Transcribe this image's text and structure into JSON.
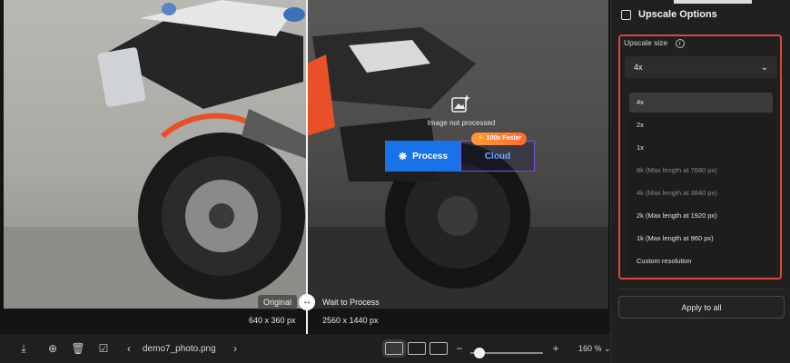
{
  "canvas": {
    "label_original": "Original",
    "label_wait": "Wait to Process",
    "original_dims": "640 x 360 px",
    "processed_dims": "2560 x 1440 px",
    "status_text": "Image not processed",
    "process_button": "Process",
    "cloud_button": "Cloud",
    "faster_badge": "100x Faster"
  },
  "toolbar": {
    "filename": "demo7_photo.png",
    "zoom": "160 %",
    "zoom_slider_fraction": 0.12
  },
  "panel": {
    "title": "Upscale Options",
    "upscale_size_label": "Upscale size",
    "info_glyph": "i",
    "selected": "4x",
    "options": [
      {
        "label": "4x",
        "enabled": true
      },
      {
        "label": "2x",
        "enabled": true
      },
      {
        "label": "1x",
        "enabled": true
      },
      {
        "label": "8k (Max length at 7680 px)",
        "enabled": false
      },
      {
        "label": "4k (Max length at 3840 px)",
        "enabled": false
      },
      {
        "label": "2k (Max length at 1920 px)",
        "enabled": true
      },
      {
        "label": "1k (Max length at 960 px)",
        "enabled": true
      },
      {
        "label": "Custom resolution",
        "enabled": true
      }
    ],
    "apply_button": "Apply to all"
  },
  "colors": {
    "accent_blue": "#1a72e8",
    "cloud_border": "#7b54e0",
    "badge_orange": "#ff7a2f",
    "highlight_red": "#e0453c"
  }
}
